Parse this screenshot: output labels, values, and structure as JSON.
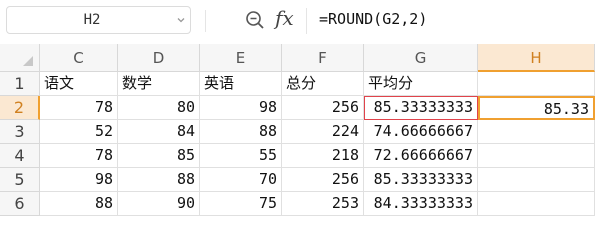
{
  "formula_bar": {
    "name_box": "H2",
    "formula": "=ROUND(G2,2)"
  },
  "columns": [
    "C",
    "D",
    "E",
    "F",
    "G",
    "H"
  ],
  "rows": [
    {
      "num": "1",
      "cells": [
        "语文",
        "数学",
        "英语",
        "总分",
        "平均分",
        ""
      ]
    },
    {
      "num": "2",
      "cells": [
        "78",
        "80",
        "98",
        "256",
        "85.33333333",
        "85.33"
      ]
    },
    {
      "num": "3",
      "cells": [
        "52",
        "84",
        "88",
        "224",
        "74.66666667",
        ""
      ]
    },
    {
      "num": "4",
      "cells": [
        "78",
        "85",
        "55",
        "218",
        "72.66666667",
        ""
      ]
    },
    {
      "num": "5",
      "cells": [
        "98",
        "88",
        "70",
        "256",
        "85.33333333",
        ""
      ]
    },
    {
      "num": "6",
      "cells": [
        "88",
        "90",
        "75",
        "253",
        "84.33333333",
        ""
      ]
    }
  ],
  "selected_cell": "H2",
  "colors": {
    "selection": "#f0a030",
    "reference_border": "#e0434b"
  }
}
